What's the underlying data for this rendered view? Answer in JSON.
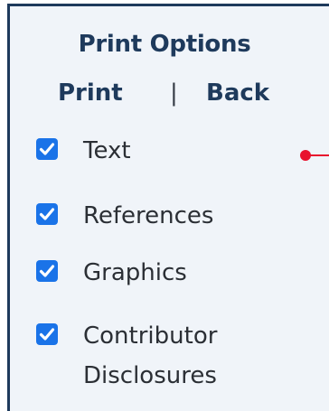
{
  "panel": {
    "title": "Print Options",
    "links": {
      "print": "Print",
      "separator": "|",
      "back": "Back"
    },
    "options": [
      {
        "label": "Text",
        "checked": true
      },
      {
        "label": "References",
        "checked": true
      },
      {
        "label": "Graphics",
        "checked": true
      },
      {
        "label_line1": "Contributor",
        "label_line2": "Disclosures",
        "checked": true
      }
    ]
  },
  "colors": {
    "accent": "#1a73e8",
    "heading": "#1e3a5c",
    "panel_bg": "#f0f4f9",
    "marker": "#e8112d"
  }
}
